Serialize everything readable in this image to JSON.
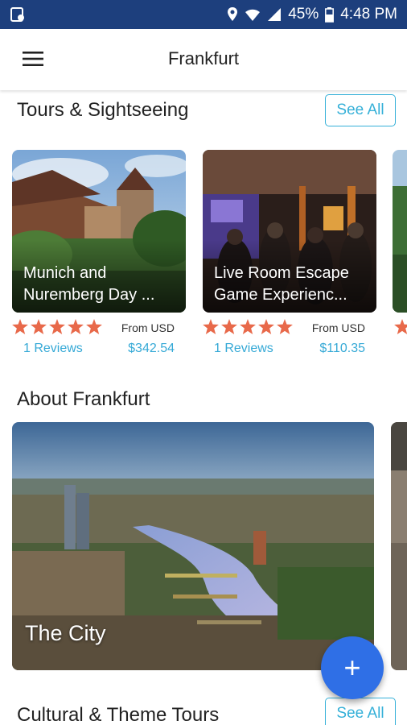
{
  "status_bar": {
    "battery_percent": "45%",
    "time": "4:48 PM",
    "icons": [
      "app-notification-icon",
      "location-icon",
      "wifi-icon",
      "signal-icon",
      "battery-icon"
    ]
  },
  "app_bar": {
    "title": "Frankfurt",
    "menu_icon": "hamburger-menu-icon"
  },
  "sections": {
    "tours": {
      "title": "Tours & Sightseeing",
      "see_all": "See All",
      "cards": [
        {
          "title": "Munich and\nNuremberg Day ...",
          "rating": 5,
          "from_label": "From USD",
          "reviews": "1 Reviews",
          "price": "$342.54"
        },
        {
          "title": "Live Room Escape\nGame Experienc...",
          "rating": 5,
          "from_label": "From USD",
          "reviews": "1 Reviews",
          "price": "$110.35"
        }
      ]
    },
    "about": {
      "title": "About Frankfurt",
      "cards": [
        {
          "label": "The City"
        }
      ]
    },
    "cultural": {
      "title": "Cultural & Theme Tours",
      "see_all": "See All"
    }
  },
  "fab": {
    "label": "+"
  },
  "colors": {
    "status_bar": "#1d3f7d",
    "accent": "#35b0d8",
    "star": "#e8694a",
    "fab": "#2f6fe6"
  }
}
